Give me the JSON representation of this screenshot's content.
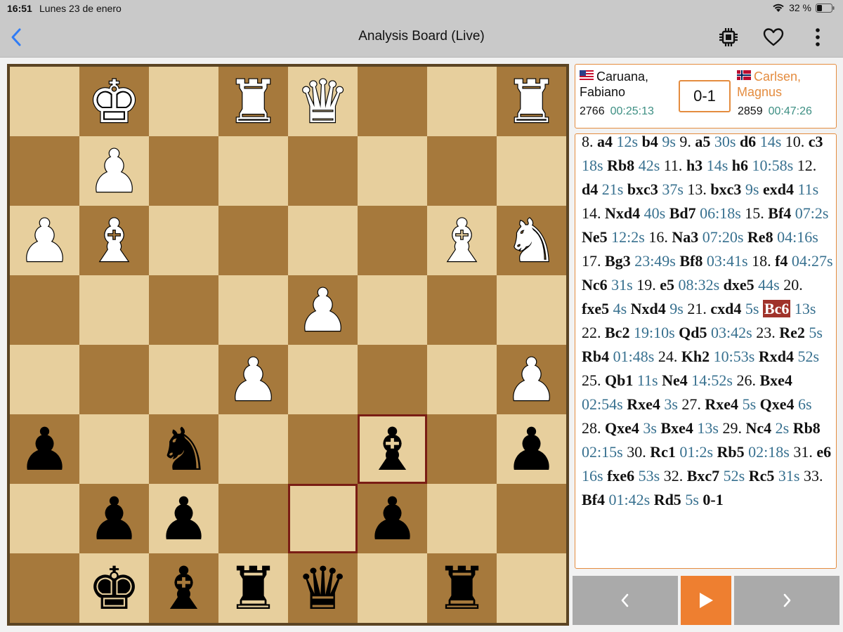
{
  "status_bar": {
    "time": "16:51",
    "date": "Lunes 23 de enero",
    "battery": "32 %"
  },
  "nav": {
    "title": "Analysis Board (Live)",
    "icons": [
      "chevron-left-icon",
      "chip-icon",
      "heart-icon",
      "more-vertical-icon"
    ]
  },
  "colors": {
    "light_square": "#e7cf9d",
    "dark_square": "#a6793c",
    "accent": "#ee7f30",
    "highlight": "#7a1d14",
    "current_move": "#a0322a",
    "clock": "#3d8f83",
    "move_time": "#37708f"
  },
  "board": {
    "ranks": [
      [
        "",
        "wk",
        "",
        "wr",
        "wq",
        "",
        "",
        "wr"
      ],
      [
        "",
        "wp",
        "",
        "",
        "",
        "",
        "",
        ""
      ],
      [
        "wp",
        "wb",
        "",
        "",
        "",
        "",
        "wb",
        "wn"
      ],
      [
        "",
        "",
        "",
        "",
        "wp",
        "",
        "",
        ""
      ],
      [
        "",
        "",
        "",
        "wp",
        "",
        "",
        "",
        "wp"
      ],
      [
        "bp",
        "",
        "bn",
        "",
        "",
        "bb",
        "",
        "bp"
      ],
      [
        "",
        "bp",
        "bp",
        "",
        "",
        "bp",
        "",
        ""
      ],
      [
        "",
        "bk",
        "bb",
        "br",
        "bq",
        "",
        "br",
        ""
      ]
    ],
    "highlighted": [
      [
        5,
        5
      ],
      [
        6,
        4
      ]
    ]
  },
  "players": {
    "white": {
      "name": "Caruana, Fabiano",
      "flag": "us-flag",
      "elo": "2766",
      "clock": "00:25:13"
    },
    "black": {
      "name": "Carlsen, Magnus",
      "flag": "norway-flag",
      "elo": "2859",
      "clock": "00:47:26"
    },
    "score": "0-1"
  },
  "moves": [
    {
      "n": "8.",
      "w": "a4",
      "wt": "12s",
      "b": "b4",
      "bt": "9s"
    },
    {
      "n": "9.",
      "w": "a5",
      "wt": "30s",
      "b": "d6",
      "bt": "14s"
    },
    {
      "n": "10.",
      "w": "c3",
      "wt": "18s",
      "b": "Rb8",
      "bt": "42s"
    },
    {
      "n": "11.",
      "w": "h3",
      "wt": "14s",
      "b": "h6",
      "bt": "10:58s"
    },
    {
      "n": "12.",
      "w": "d4",
      "wt": "21s",
      "b": "bxc3",
      "bt": "37s"
    },
    {
      "n": "13.",
      "w": "bxc3",
      "wt": "9s",
      "b": "exd4",
      "bt": "11s"
    },
    {
      "n": "14.",
      "w": "Nxd4",
      "wt": "40s",
      "b": "Bd7",
      "bt": "06:18s"
    },
    {
      "n": "15.",
      "w": "Bf4",
      "wt": "07:2s",
      "b": "Ne5",
      "bt": "12:2s"
    },
    {
      "n": "16.",
      "w": "Na3",
      "wt": "07:20s",
      "b": "Re8",
      "bt": "04:16s"
    },
    {
      "n": "17.",
      "w": "Bg3",
      "wt": "23:49s",
      "b": "Bf8",
      "bt": "03:41s"
    },
    {
      "n": "18.",
      "w": "f4",
      "wt": "04:27s",
      "b": "Nc6",
      "bt": "31s"
    },
    {
      "n": "19.",
      "w": "e5",
      "wt": "08:32s",
      "b": "dxe5",
      "bt": "44s"
    },
    {
      "n": "20.",
      "w": "fxe5",
      "wt": "4s",
      "b": "Nxd4",
      "bt": "9s"
    },
    {
      "n": "21.",
      "w": "cxd4",
      "wt": "5s",
      "b": "Bc6",
      "bt": "13s",
      "current": "b"
    },
    {
      "n": "22.",
      "w": "Bc2",
      "wt": "19:10s",
      "b": "Qd5",
      "bt": "03:42s"
    },
    {
      "n": "23.",
      "w": "Re2",
      "wt": "5s",
      "b": "Rb4",
      "bt": "01:48s"
    },
    {
      "n": "24.",
      "w": "Kh2",
      "wt": "10:53s",
      "b": "Rxd4",
      "bt": "52s"
    },
    {
      "n": "25.",
      "w": "Qb1",
      "wt": "11s",
      "b": "Ne4",
      "bt": "14:52s"
    },
    {
      "n": "26.",
      "w": "Bxe4",
      "wt": "02:54s",
      "b": "Rxe4",
      "bt": "3s"
    },
    {
      "n": "27.",
      "w": "Rxe4",
      "wt": "5s",
      "b": "Qxe4",
      "bt": "6s"
    },
    {
      "n": "28.",
      "w": "Qxe4",
      "wt": "3s",
      "b": "Bxe4",
      "bt": "13s"
    },
    {
      "n": "29.",
      "w": "Nc4",
      "wt": "2s",
      "b": "Rb8",
      "bt": "02:15s"
    },
    {
      "n": "30.",
      "w": "Rc1",
      "wt": "01:2s",
      "b": "Rb5",
      "bt": "02:18s"
    },
    {
      "n": "31.",
      "w": "e6",
      "wt": "16s",
      "b": "fxe6",
      "bt": "53s"
    },
    {
      "n": "32.",
      "w": "Bxc7",
      "wt": "52s",
      "b": "Rc5",
      "bt": "31s"
    },
    {
      "n": "33.",
      "w": "Bf4",
      "wt": "01:42s",
      "b": "Rd5",
      "bt": "5s"
    }
  ],
  "result": "0-1",
  "controls": {
    "prev": "chevron-left-icon",
    "play": "play-icon",
    "next": "chevron-right-icon"
  }
}
